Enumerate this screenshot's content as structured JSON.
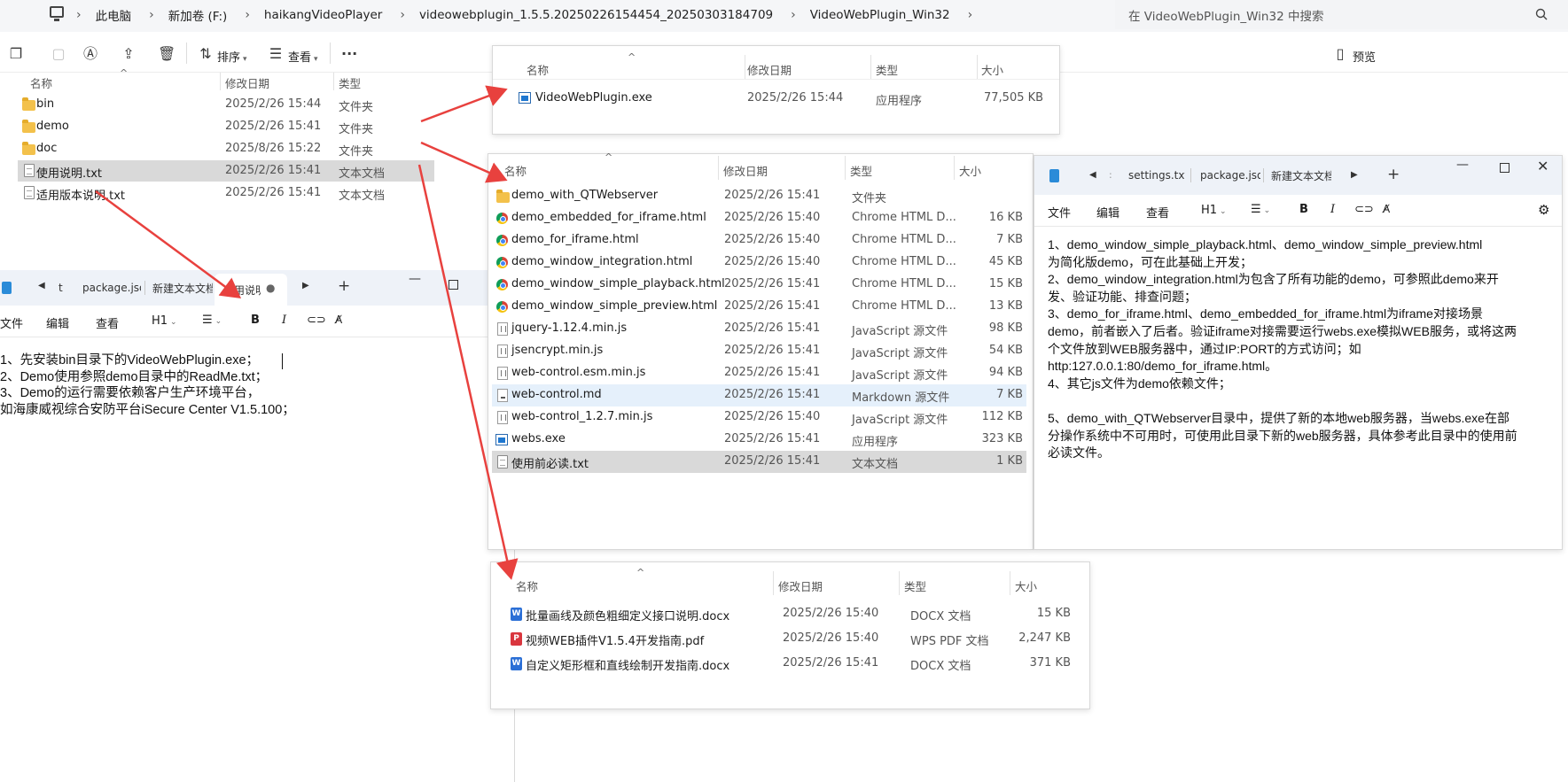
{
  "address_bar": {
    "crumbs": [
      "此电脑",
      "新加卷 (F:)",
      "haikangVideoPlayer",
      "videowebplugin_1.5.5.20250226154454_20250303184709",
      "VideoWebPlugin_Win32"
    ],
    "search_placeholder": "在 VideoWebPlugin_Win32 中搜索"
  },
  "toolbar": {
    "sort_label": "排序",
    "view_label": "查看",
    "preview_label": "预览"
  },
  "main_explorer": {
    "headers": {
      "name": "名称",
      "date": "修改日期",
      "type": "类型"
    },
    "rows": [
      {
        "name": "bin",
        "date": "2025/2/26 15:44",
        "type": "文件夹",
        "icon": "folder"
      },
      {
        "name": "demo",
        "date": "2025/2/26 15:41",
        "type": "文件夹",
        "icon": "folder"
      },
      {
        "name": "doc",
        "date": "2025/8/26 15:22",
        "type": "文件夹",
        "icon": "folder"
      },
      {
        "name": "使用说明.txt",
        "date": "2025/2/26 15:41",
        "type": "文本文档",
        "icon": "text"
      },
      {
        "name": "适用版本说明.txt",
        "date": "2025/2/26 15:41",
        "type": "文本文档",
        "icon": "text"
      }
    ]
  },
  "bin_panel": {
    "headers": {
      "name": "名称",
      "date": "修改日期",
      "type": "类型",
      "size": "大小"
    },
    "rows": [
      {
        "name": "VideoWebPlugin.exe",
        "date": "2025/2/26 15:44",
        "type": "应用程序",
        "size": "77,505 KB"
      }
    ]
  },
  "demo_panel": {
    "headers": {
      "name": "名称",
      "date": "修改日期",
      "type": "类型",
      "size": "大小"
    },
    "rows": [
      {
        "name": "demo_with_QTWebserver",
        "date": "2025/2/26 15:41",
        "type": "文件夹",
        "size": ""
      },
      {
        "name": "demo_embedded_for_iframe.html",
        "date": "2025/2/26 15:40",
        "type": "Chrome HTML D...",
        "size": "16 KB"
      },
      {
        "name": "demo_for_iframe.html",
        "date": "2025/2/26 15:40",
        "type": "Chrome HTML D...",
        "size": "7 KB"
      },
      {
        "name": "demo_window_integration.html",
        "date": "2025/2/26 15:40",
        "type": "Chrome HTML D...",
        "size": "45 KB"
      },
      {
        "name": "demo_window_simple_playback.html",
        "date": "2025/2/26 15:41",
        "type": "Chrome HTML D...",
        "size": "15 KB"
      },
      {
        "name": "demo_window_simple_preview.html",
        "date": "2025/2/26 15:41",
        "type": "Chrome HTML D...",
        "size": "13 KB"
      },
      {
        "name": "jquery-1.12.4.min.js",
        "date": "2025/2/26 15:41",
        "type": "JavaScript 源文件",
        "size": "98 KB"
      },
      {
        "name": "jsencrypt.min.js",
        "date": "2025/2/26 15:41",
        "type": "JavaScript 源文件",
        "size": "54 KB"
      },
      {
        "name": "web-control.esm.min.js",
        "date": "2025/2/26 15:41",
        "type": "JavaScript 源文件",
        "size": "94 KB"
      },
      {
        "name": "web-control.md",
        "date": "2025/2/26 15:41",
        "type": "Markdown 源文件",
        "size": "7 KB"
      },
      {
        "name": "web-control_1.2.7.min.js",
        "date": "2025/2/26 15:40",
        "type": "JavaScript 源文件",
        "size": "112 KB"
      },
      {
        "name": "webs.exe",
        "date": "2025/2/26 15:41",
        "type": "应用程序",
        "size": "323 KB"
      },
      {
        "name": "使用前必读.txt",
        "date": "2025/2/26 15:41",
        "type": "文本文档",
        "size": "1 KB"
      }
    ]
  },
  "doc_panel": {
    "headers": {
      "name": "名称",
      "date": "修改日期",
      "type": "类型",
      "size": "大小"
    },
    "rows": [
      {
        "name": "批量画线及颜色粗细定义接口说明.docx",
        "date": "2025/2/26 15:40",
        "type": "DOCX 文档",
        "size": "15 KB"
      },
      {
        "name": "视频WEB插件V1.5.4开发指南.pdf",
        "date": "2025/2/26 15:40",
        "type": "WPS PDF 文档",
        "size": "2,247 KB"
      },
      {
        "name": "自定义矩形框和直线绘制开发指南.docx",
        "date": "2025/2/26 15:41",
        "type": "DOCX 文档",
        "size": "371 KB"
      }
    ]
  },
  "notepad_left": {
    "tabs": [
      "t",
      "package.json",
      "新建文本文档",
      "使用说明"
    ],
    "menu": {
      "file": "文件",
      "edit": "编辑",
      "view": "查看",
      "heading": "H1"
    },
    "lines": [
      "1、先安装bin目录下的VideoWebPlugin.exe；",
      "2、Demo使用参照demo目录中的ReadMe.txt；",
      "3、Demo的运行需要依赖客户生产环境平台，",
      "如海康威视综合安防平台iSecure Center V1.5.100；"
    ]
  },
  "notepad_right": {
    "tabs": [
      "settings.txt",
      "package.json",
      "新建文本文档"
    ],
    "menu": {
      "file": "文件",
      "edit": "编辑",
      "view": "查看",
      "heading": "H1"
    },
    "lines": [
      "1、demo_window_simple_playback.html、demo_window_simple_preview.html",
      "为简化版demo，可在此基础上开发；",
      "2、demo_window_integration.html为包含了所有功能的demo，可参照此demo来开",
      "发、验证功能、排查问题；",
      "3、demo_for_iframe.html、demo_embedded_for_iframe.html为iframe对接场景",
      "demo，前者嵌入了后者。验证iframe对接需要运行webs.exe模拟WEB服务，或将这两",
      "个文件放到WEB服务器中，通过IP:PORT的方式访问；如",
      "http:127.0.0.1:80/demo_for_iframe.html。",
      "4、其它js文件为demo依赖文件；",
      "",
      "5、demo_with_QTWebserver目录中，提供了新的本地web服务器，当webs.exe在部",
      "分操作系统中不可用时，可使用此目录下新的web服务器，具体参考此目录中的使用前",
      "必读文件。"
    ]
  },
  "colors": {
    "arrow": "#e8413e",
    "selected_row": "#d9d9d9",
    "hover_row": "#e5f0fb",
    "tabbar": "#eef2f8"
  }
}
